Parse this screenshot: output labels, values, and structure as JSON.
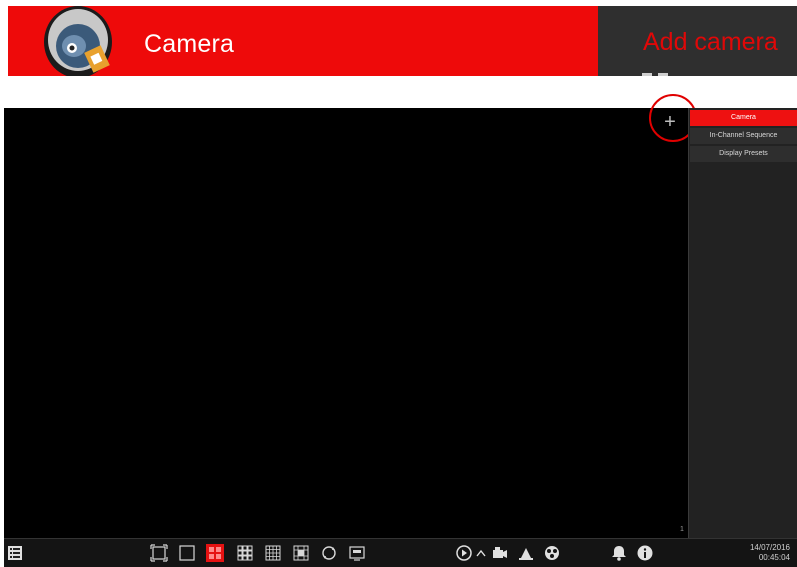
{
  "banner": {
    "title": "Camera",
    "right_title": "Add camera"
  },
  "screen": {
    "add_button_symbol": "+",
    "channel_number": "1",
    "side_menu": [
      {
        "label": "Camera",
        "active": true
      },
      {
        "label": "In-Channel Sequence",
        "active": false
      },
      {
        "label": "Display Presets",
        "active": false
      }
    ]
  },
  "taskbar": {
    "start_menu_icon": "menu-list-icon",
    "layout_icons": [
      "fullscreen-icon",
      "single-view-icon",
      "quad-view-icon",
      "nine-view-icon",
      "sixteen-view-icon",
      "custom-view-icon",
      "sequence-view-icon",
      "osd-icon"
    ],
    "active_layout": "quad-view-icon",
    "playback_icons": [
      "playback-icon",
      "expand-up-icon",
      "record-icon",
      "manual-alarm-icon",
      "disk-icon"
    ],
    "alarm_icons": [
      "alarm-bell-icon",
      "info-icon"
    ],
    "date": "14/07/2016",
    "time": "00:45:04"
  },
  "colors": {
    "accent": "#ee0a0a",
    "panel": "#222222",
    "screen_bg": "#000000"
  }
}
